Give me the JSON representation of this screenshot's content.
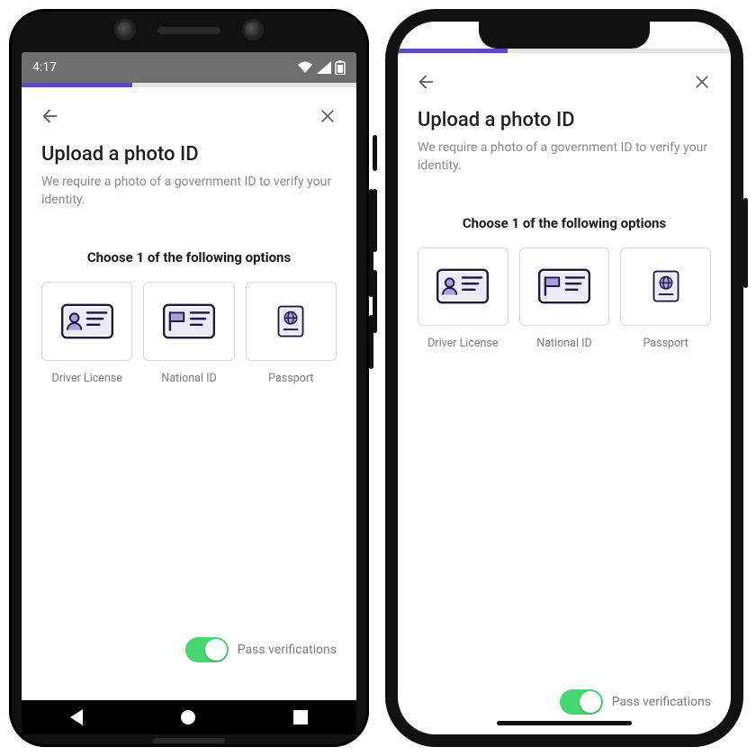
{
  "status": {
    "time": "4:17"
  },
  "progress": {
    "fraction": 0.33
  },
  "header": {
    "title": "Upload a photo ID",
    "subtitle": "We require a photo of a government ID to verify your identity."
  },
  "choose_label": "Choose 1 of the following options",
  "options": [
    {
      "id": "driver-license",
      "label": "Driver License",
      "icon": "driver-license-icon"
    },
    {
      "id": "national-id",
      "label": "National ID",
      "icon": "national-id-icon"
    },
    {
      "id": "passport",
      "label": "Passport",
      "icon": "passport-icon"
    }
  ],
  "toggle": {
    "label": "Pass verifications",
    "on": true
  },
  "accent_color": "#5b4db1",
  "icon_stroke": "#1e1845",
  "icon_fill": "#a9a2d7"
}
